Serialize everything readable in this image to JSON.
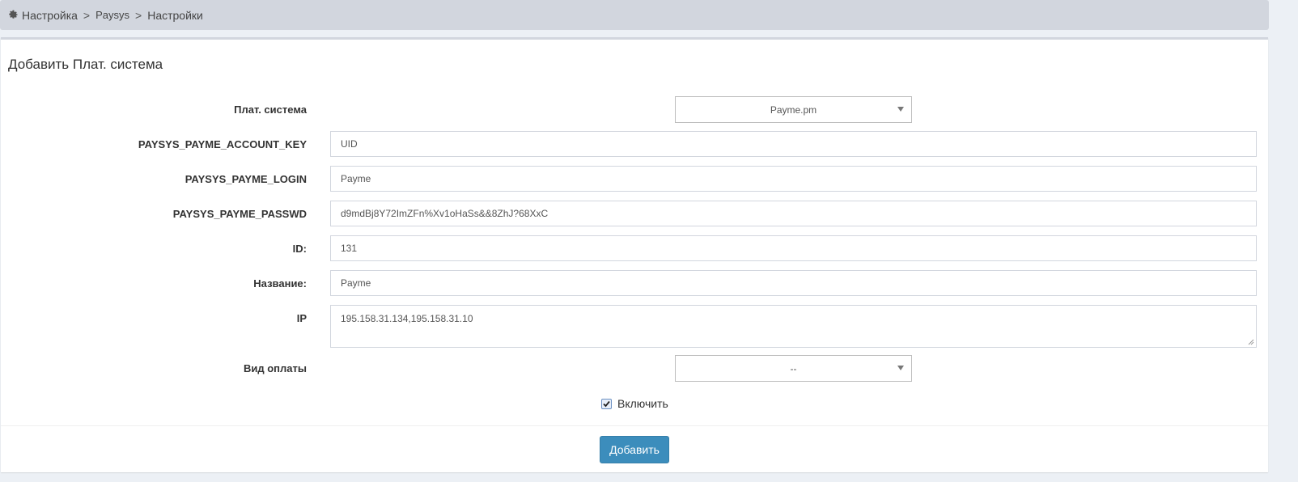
{
  "breadcrumb": {
    "items": [
      "Настройка",
      "Paysys",
      "Настройки"
    ],
    "separator": ">",
    "icon": "gear-icon"
  },
  "form": {
    "title": "Добавить Плат. система",
    "paysys": {
      "label": "Плат. система",
      "value": "Payme.pm"
    },
    "account_key": {
      "label": "PAYSYS_PAYME_ACCOUNT_KEY",
      "value": "UID"
    },
    "login": {
      "label": "PAYSYS_PAYME_LOGIN",
      "value": "Payme"
    },
    "passwd": {
      "label": "PAYSYS_PAYME_PASSWD",
      "value": "d9mdBj8Y72ImZFn%Xv1oHaSs&&8ZhJ?68XxC"
    },
    "id": {
      "label": "ID:",
      "value": "131"
    },
    "name": {
      "label": "Название:",
      "value": "Payme"
    },
    "ip": {
      "label": "IP",
      "value": "195.158.31.134,195.158.31.10"
    },
    "payment_type": {
      "label": "Вид оплаты",
      "value": "--"
    },
    "enable": {
      "label": "Включить",
      "checked": true
    },
    "submit_label": "Добавить"
  },
  "colors": {
    "primary_button": "#3c8dbc",
    "breadcrumb_bg": "#d2d6de"
  }
}
